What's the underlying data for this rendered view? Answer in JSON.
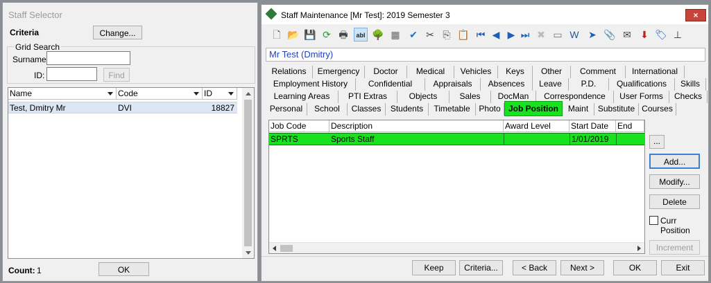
{
  "selector": {
    "title": "Staff Selector",
    "criteria_label": "Criteria",
    "change_button": "Change...",
    "grid_search_label": "Grid Search",
    "surname_label": "Surname:",
    "surname_value": "",
    "id_label": "ID:",
    "id_value": "",
    "find_button": "Find",
    "columns": [
      "Name",
      "Code",
      "ID"
    ],
    "rows": [
      {
        "name": "Test, Dmitry Mr",
        "code": "DVI",
        "id": "18827"
      }
    ],
    "count_label": "Count:",
    "count_value": "1",
    "ok_button": "OK"
  },
  "maintenance": {
    "title": "Staff Maintenance  [Mr Test]:  2019 Semester 3",
    "close_icon": "×",
    "staff_name": "Mr Test (Dmitry)",
    "tabs_row1": [
      "Relations",
      "Emergency",
      "Doctor",
      "Medical",
      "Vehicles",
      "Keys",
      "Other",
      "Comment",
      "International"
    ],
    "tabs_row2": [
      "Employment History",
      "Confidential",
      "Appraisals",
      "Absences",
      "Leave",
      "P.D.",
      "Qualifications",
      "Skills"
    ],
    "tabs_row3": [
      "Learning Areas",
      "PTI Extras",
      "Objects",
      "Sales",
      "DocMan",
      "Correspondence",
      "User Forms",
      "Checks"
    ],
    "tabs_row4": [
      "Personal",
      "School",
      "Classes",
      "Students",
      "Timetable",
      "Photo",
      "Job Position",
      "Maint",
      "Substitute",
      "Courses"
    ],
    "job_columns": [
      "Job Code",
      "Description",
      "Award Level",
      "Start Date",
      "End Dat"
    ],
    "job_rows": [
      {
        "code": "SPRTS",
        "description": "Sports Staff",
        "award": "",
        "start": "1/01/2019",
        "end": ""
      }
    ],
    "ellipsis_button": "...",
    "add_button": "Add...",
    "modify_button": "Modify...",
    "delete_button": "Delete",
    "curr_position_label": "Curr Position",
    "increment_button": "Increment",
    "bottom_buttons": {
      "keep": "Keep",
      "criteria": "Criteria...",
      "back": "< Back",
      "next": "Next >",
      "ok": "OK",
      "exit": "Exit"
    },
    "toolbar_icons": [
      "new-doc-icon",
      "open-folder-icon",
      "save-icon",
      "refresh-icon",
      "print-icon",
      "text-field-icon",
      "tree-icon",
      "calculator-icon",
      "spellcheck-icon",
      "cut-icon",
      "copy-icon",
      "paste-icon",
      "first-record-icon",
      "previous-record-icon",
      "next-record-icon",
      "last-record-icon",
      "delete-icon",
      "id-card-icon",
      "word-export-icon",
      "pin-icon",
      "clipboard-icon",
      "stamp-icon",
      "download-icon",
      "tag-icon",
      "hierarchy-icon"
    ],
    "toolbar_glyphs": [
      "🗋",
      "📂",
      "💾",
      "⟳",
      "🖶",
      "abl",
      "🌳",
      "▦",
      "✔",
      "✂",
      "⎘",
      "📋",
      "⏮",
      "◀",
      "▶",
      "⏭",
      "✖",
      "▭",
      "W",
      "➤",
      "📎",
      "✉",
      "⬇",
      "🏷",
      "⊥"
    ]
  },
  "colors": {
    "selected_row": "#18e21e",
    "name_text": "#1e3fbf",
    "close_button": "#c8443b"
  }
}
